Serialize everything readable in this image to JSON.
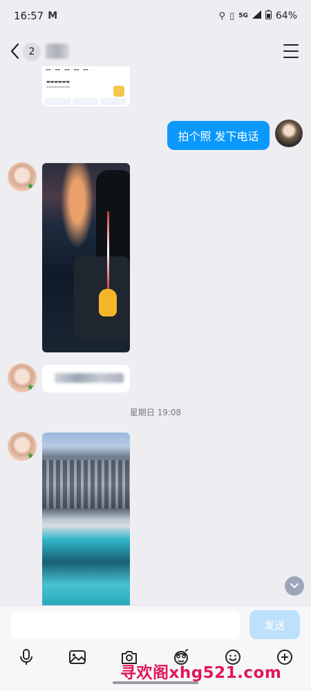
{
  "status_bar": {
    "time": "16:57",
    "mail_glyph": "M",
    "network": "5G",
    "battery": "64%"
  },
  "nav": {
    "unread_count": "2"
  },
  "messages": {
    "sent_text": "拍个照  发下电话",
    "timestamp": "星期日 19:08"
  },
  "input": {
    "placeholder": "",
    "send_label": "发送"
  },
  "watermark": "寻欢阁xhg521.com",
  "colors": {
    "sent_bubble": "#0a98fc",
    "send_button_disabled": "#bde0fb",
    "background": "#ededf2"
  },
  "icons": [
    "back-icon",
    "menu-icon",
    "microphone-icon",
    "image-icon",
    "camera-icon",
    "sticker-icon",
    "emoji-icon",
    "add-icon",
    "chevron-down-icon"
  ]
}
